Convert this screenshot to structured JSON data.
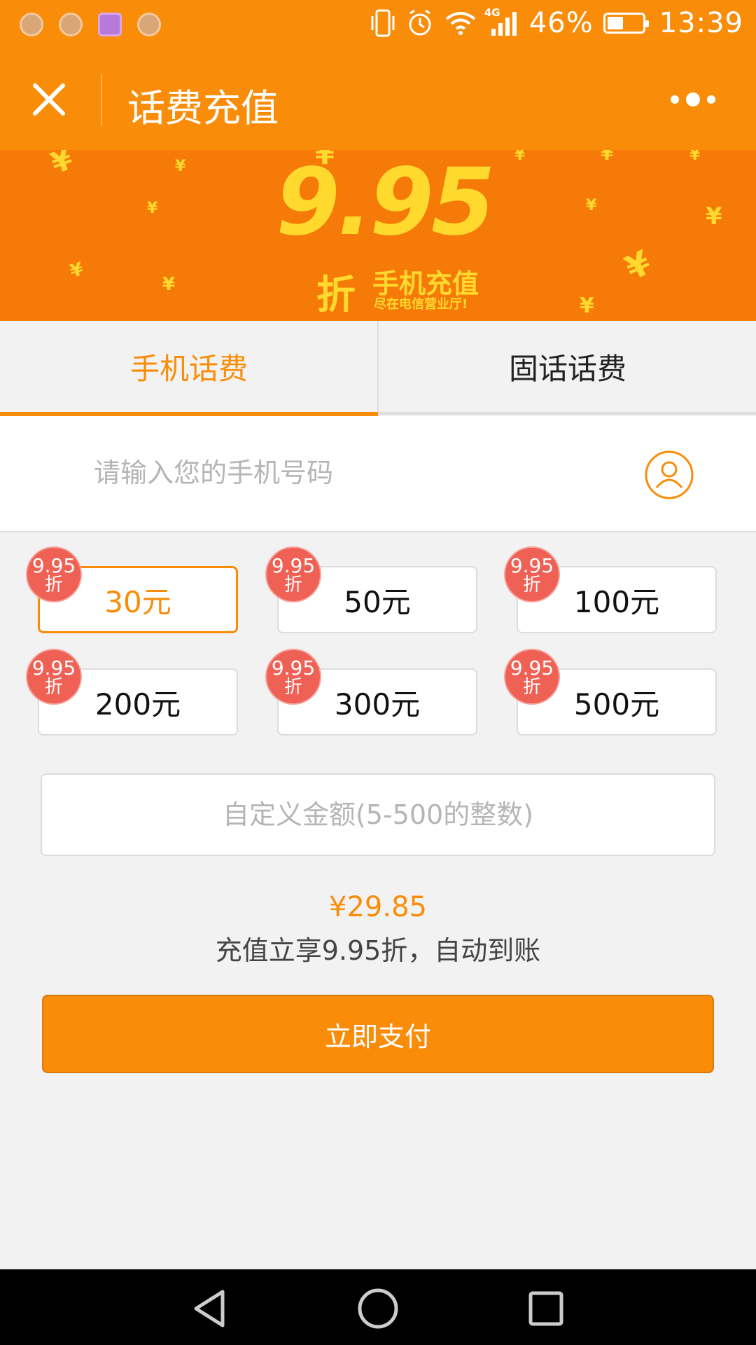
{
  "status_bar": {
    "network": "4G",
    "battery": "46%",
    "battery_level": 0.46,
    "time": "13:39"
  },
  "header": {
    "title": "话费充值"
  },
  "banner": {
    "big_number": "9.95",
    "discount": "折",
    "headline": "手机充值",
    "subline": "尽在电信营业厅!"
  },
  "tabs": [
    {
      "label": "手机话费",
      "active": true
    },
    {
      "label": "固话话费",
      "active": false
    }
  ],
  "phone": {
    "placeholder": "请输入您的手机号码",
    "value": ""
  },
  "amounts": [
    {
      "label": "30元",
      "badge_num": "9.95",
      "badge_unit": "折",
      "selected": true
    },
    {
      "label": "50元",
      "badge_num": "9.95",
      "badge_unit": "折",
      "selected": false
    },
    {
      "label": "100元",
      "badge_num": "9.95",
      "badge_unit": "折",
      "selected": false
    },
    {
      "label": "200元",
      "badge_num": "9.95",
      "badge_unit": "折",
      "selected": false
    },
    {
      "label": "300元",
      "badge_num": "9.95",
      "badge_unit": "折",
      "selected": false
    },
    {
      "label": "500元",
      "badge_num": "9.95",
      "badge_unit": "折",
      "selected": false
    }
  ],
  "custom_amount": {
    "placeholder": "自定义金额(5-500的整数)"
  },
  "summary": {
    "price": "¥29.85",
    "note": "充值立享9.95折，自动到账"
  },
  "pay_button": {
    "label": "立即支付"
  },
  "colors": {
    "accent": "#f98d0a",
    "banner": "#f57a08",
    "badge": "#ef6055",
    "banner_text": "#ffd92e"
  }
}
